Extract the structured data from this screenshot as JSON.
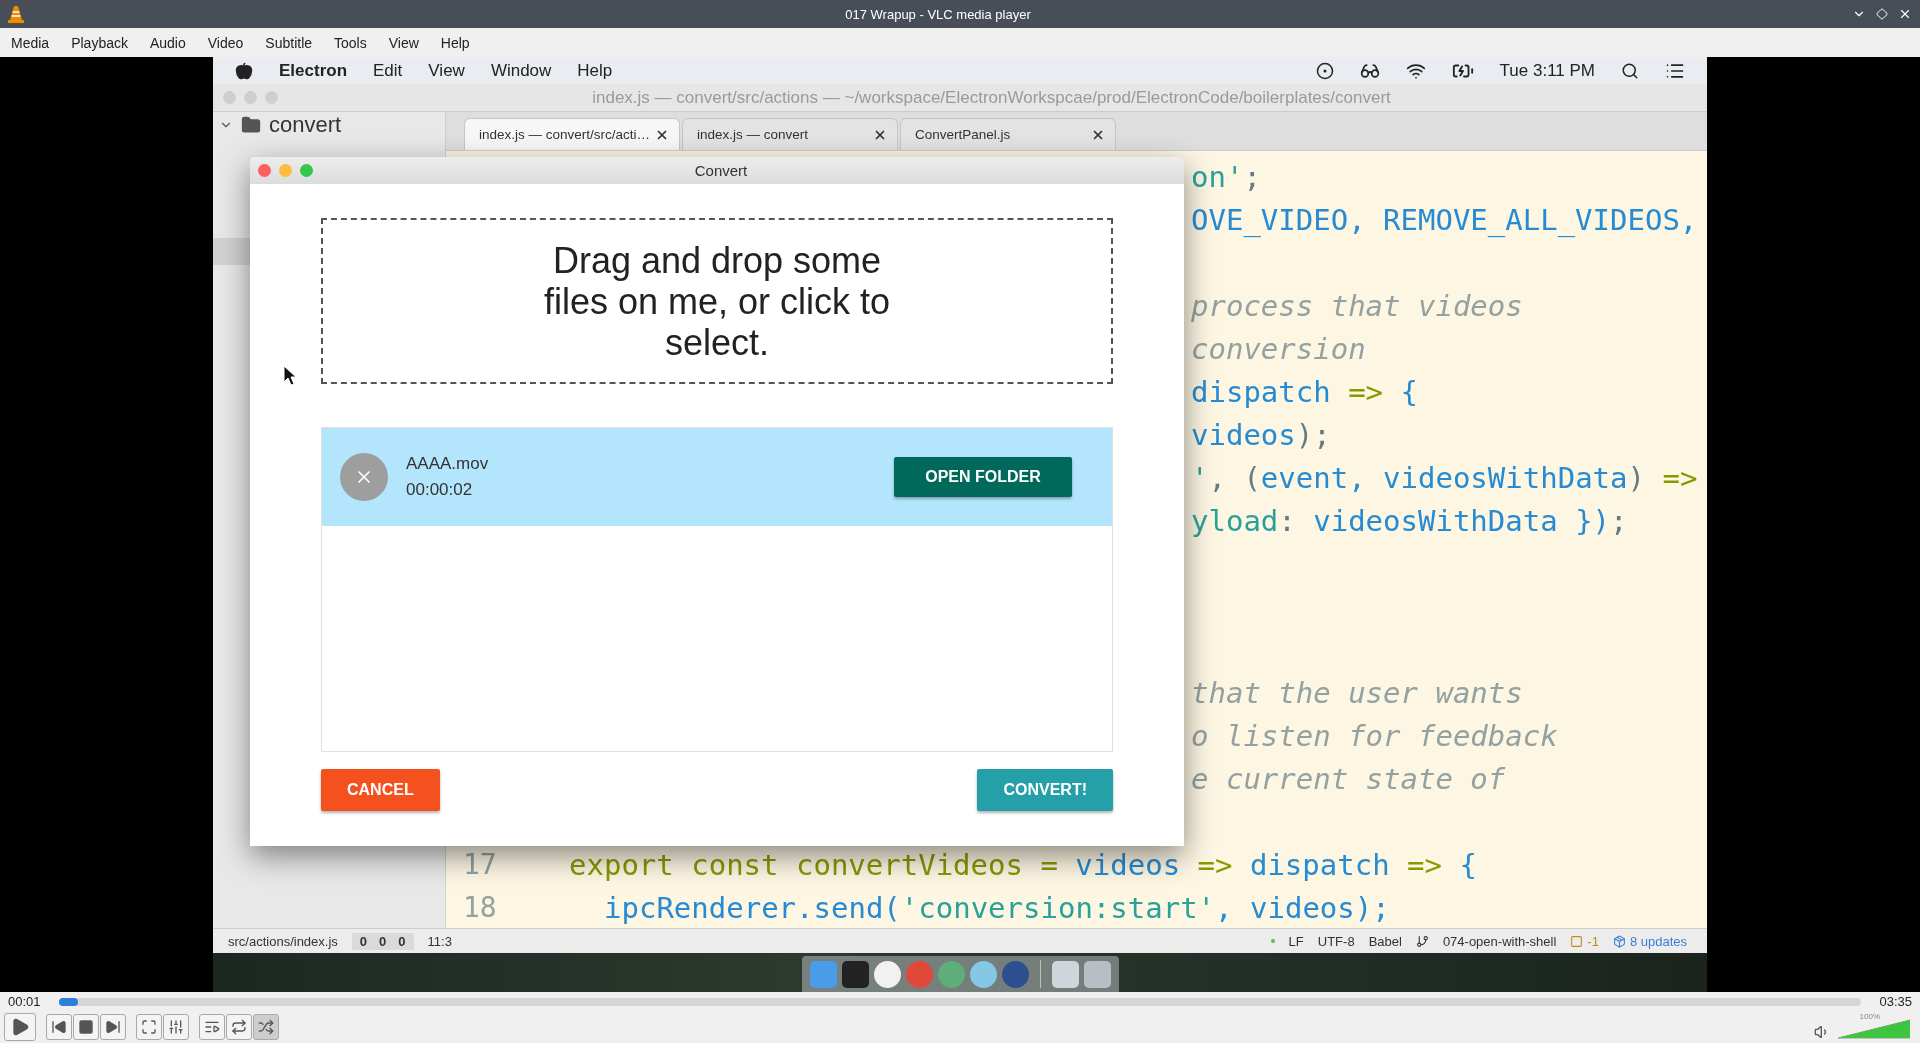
{
  "vlc": {
    "title": "017 Wrapup - VLC media player",
    "menu": [
      "Media",
      "Playback",
      "Audio",
      "Video",
      "Subtitle",
      "Tools",
      "View",
      "Help"
    ]
  },
  "screen": {
    "menubar": {
      "app": "Electron",
      "menus": [
        "Edit",
        "View",
        "Window",
        "Help"
      ],
      "clock": "Tue 3:11 PM"
    },
    "atom": {
      "title": "index.js — convert/src/actions — ~/workspace/ElectronWorkspcae/prod/ElectronCode/boilerplates/convert",
      "tree": {
        "root": "convert",
        "expanded": true
      },
      "tabs": [
        {
          "label": "index.js — convert/src/acti…",
          "selected": true
        },
        {
          "label": "index.js — convert",
          "selected": false
        },
        {
          "label": "ConvertPanel.js",
          "selected": false
        }
      ],
      "code_lines": [
        {
          "kind": "code",
          "segments": [
            {
              "text": "on'",
              "kind": "str"
            },
            {
              "text": ";",
              "kind": "punct"
            }
          ]
        },
        {
          "kind": "code",
          "segments": [
            {
              "text": "OVE_VIDEO, REMOVE_ALL_VIDEOS,",
              "kind": "ident"
            }
          ]
        },
        {
          "kind": "blank"
        },
        {
          "kind": "code",
          "segments": [
            {
              "text": "process that videos",
              "kind": "com"
            }
          ]
        },
        {
          "kind": "code",
          "segments": [
            {
              "text": "conversion",
              "kind": "com"
            }
          ]
        },
        {
          "kind": "code",
          "segments": [
            {
              "text": "dispatch ",
              "kind": "ident"
            },
            {
              "text": "=>",
              "kind": "kw"
            },
            {
              "text": " {",
              "kind": "ident"
            }
          ]
        },
        {
          "kind": "code",
          "segments": [
            {
              "text": "videos",
              "kind": "ident"
            },
            {
              "text": ");",
              "kind": "punct"
            }
          ]
        },
        {
          "kind": "code",
          "segments": [
            {
              "text": "'",
              "kind": "str"
            },
            {
              "text": ", (",
              "kind": "punct"
            },
            {
              "text": "event, videosWithData",
              "kind": "ident"
            },
            {
              "text": ") ",
              "kind": "punct"
            },
            {
              "text": "=>",
              "kind": "kw"
            }
          ]
        },
        {
          "kind": "code",
          "segments": [
            {
              "text": "yload",
              "kind": "str"
            },
            {
              "text": ": ",
              "kind": "punct"
            },
            {
              "text": "videosWithData })",
              "kind": "ident"
            },
            {
              "text": ";",
              "kind": "punct"
            }
          ]
        },
        {
          "kind": "blank"
        },
        {
          "kind": "blank"
        },
        {
          "kind": "blank"
        },
        {
          "kind": "code",
          "segments": [
            {
              "text": "that the user wants",
              "kind": "com"
            }
          ]
        },
        {
          "kind": "code",
          "segments": [
            {
              "text": "o listen for feedback",
              "kind": "com"
            }
          ]
        },
        {
          "kind": "code",
          "segments": [
            {
              "text": "e current state of",
              "kind": "com"
            }
          ]
        },
        {
          "kind": "blank"
        },
        {
          "kind": "numbered",
          "number": "17",
          "segments": [
            {
              "text": "export const convertVideos = ",
              "kind": "kw"
            },
            {
              "text": "videos",
              "kind": "ident"
            },
            {
              "text": " => ",
              "kind": "kw"
            },
            {
              "text": "dispatch",
              "kind": "ident"
            },
            {
              "text": " => ",
              "kind": "kw"
            },
            {
              "text": "{",
              "kind": "ident"
            }
          ],
          "children": [
            {
              "kind": "numbered",
              "number": "18",
              "segments": [
                {
                  "text": "ipcRenderer.send(",
                  "kind": "ident"
                },
                {
                  "text": "'conversion:start'",
                  "kind": "str"
                },
                {
                  "text": ", videos);",
                  "kind": "ident"
                }
              ]
            }
          ]
        }
      ],
      "status_bar": {
        "path": "src/actions/index.js",
        "counts": [
          "0",
          "0",
          "0"
        ],
        "cursor": "11:3",
        "items": [
          "LF",
          "UTF-8",
          "Babel"
        ],
        "branch": "074-open-with-shell",
        "issues": "-1",
        "updates": "8 updates"
      }
    },
    "dialog": {
      "title": "Convert",
      "dropzone_lines": [
        "Drag and drop some",
        "files on me, or click to",
        "select."
      ],
      "files": [
        {
          "name": "AAAA.mov",
          "duration": "00:00:02",
          "action": "OPEN FOLDER"
        }
      ],
      "cancel": "CANCEL",
      "convert": "CONVERT!"
    }
  },
  "player": {
    "elapsed": "00:01",
    "total": "03:35",
    "level": 0.005,
    "controls": [
      {
        "kind": "play",
        "on": false
      },
      {
        "kind": "previous",
        "on": false
      },
      {
        "kind": "stop",
        "on": false
      },
      {
        "kind": "next",
        "on": false
      },
      {
        "kind": "fullscreen",
        "on": false
      },
      {
        "kind": "settings",
        "on": false
      },
      {
        "kind": "playlist",
        "on": false
      },
      {
        "kind": "loop",
        "on": false
      },
      {
        "kind": "shuffle",
        "on": true
      }
    ],
    "volume": {
      "level": 1,
      "reading": "100%"
    }
  }
}
